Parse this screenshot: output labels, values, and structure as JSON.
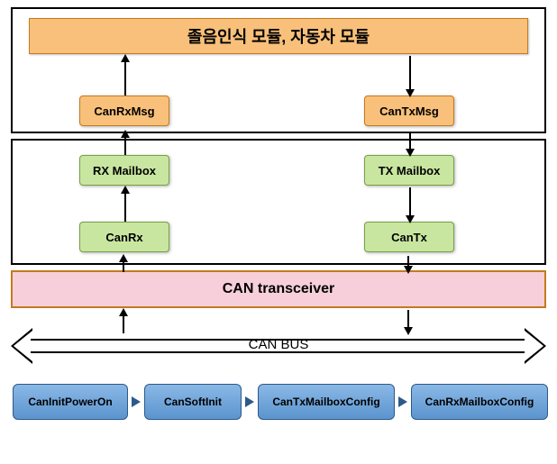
{
  "colors": {
    "orange": "#f8c07a",
    "green": "#c8e6a0",
    "pink": "#f6cfda",
    "blue": "#5b94ce"
  },
  "top_layer": {
    "title": "졸음인식 모듈, 자동차 모듈",
    "rx_msg": "CanRxMsg",
    "tx_msg": "CanTxMsg"
  },
  "mid_layer": {
    "rx_mailbox": "RX Mailbox",
    "tx_mailbox": "TX Mailbox",
    "can_rx": "CanRx",
    "can_tx": "CanTx"
  },
  "transceiver": "CAN transceiver",
  "bus": "CAN BUS",
  "init_chain": {
    "step1": "CanInitPowerOn",
    "step2": "CanSoftInit",
    "step3": "CanTxMailboxConfig",
    "step4": "CanRxMailboxConfig"
  },
  "flow": {
    "rx_path": [
      "CAN BUS",
      "CAN transceiver",
      "CanRx",
      "RX Mailbox",
      "CanRxMsg",
      "졸음인식 모듈, 자동차 모듈"
    ],
    "tx_path": [
      "졸음인식 모듈, 자동차 모듈",
      "CanTxMsg",
      "TX Mailbox",
      "CanTx",
      "CAN transceiver",
      "CAN BUS"
    ],
    "init_sequence": [
      "CanInitPowerOn",
      "CanSoftInit",
      "CanTxMailboxConfig",
      "CanRxMailboxConfig"
    ]
  }
}
